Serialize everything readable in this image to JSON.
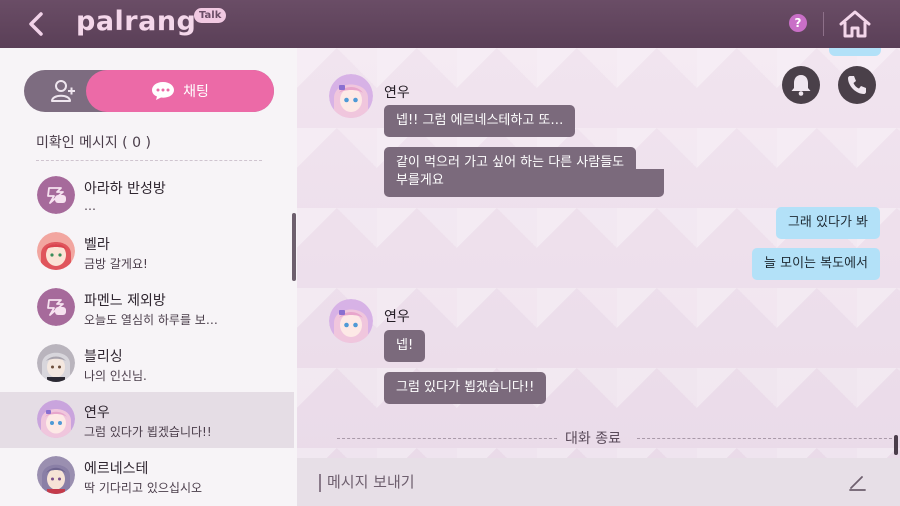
{
  "header": {
    "logo_text": "palrang",
    "logo_badge": "Talk",
    "help_label": "?"
  },
  "sidebar": {
    "tabs": {
      "chat_label": "채팅"
    },
    "unread_label": "미확인 메시지 ( 0 )",
    "chats": [
      {
        "name": "아라하 반성방",
        "preview": "…",
        "avatar": "group-icon",
        "active": false
      },
      {
        "name": "벨라",
        "preview": "금방 갈게요!",
        "avatar": "bella-avatar",
        "active": false
      },
      {
        "name": "파멘느 제외방",
        "preview": "오늘도 열심히 하루를 보…",
        "avatar": "group-icon",
        "active": false
      },
      {
        "name": "블리싱",
        "preview": "나의 인신님.",
        "avatar": "blissing-avatar",
        "active": false
      },
      {
        "name": "연우",
        "preview": "그럼 있다가 뵙겠습니다!!",
        "avatar": "yeonwoo-avatar",
        "active": true
      },
      {
        "name": "에르네스테",
        "preview": "딱 기다리고 있으십시오",
        "avatar": "erneste-avatar",
        "active": false
      }
    ]
  },
  "chat": {
    "messages": [
      {
        "sender": "연우",
        "text": "넵!! 그럼 에르네스테하고 또…"
      },
      {
        "text": "같이 먹으러 가고 싶어 하는 다른 사람들도"
      },
      {
        "text": "부를게요"
      },
      {
        "self": true,
        "text": "그래 있다가 봐"
      },
      {
        "self": true,
        "text": "늘 모이는 복도에서"
      },
      {
        "sender": "연우",
        "text": "넵!"
      },
      {
        "text": "그럼 있다가 뵙겠습니다!!"
      }
    ],
    "end_label": "대화 종료"
  },
  "input": {
    "placeholder": "메시지 보내기"
  },
  "colors": {
    "header": "#5a3f57",
    "accent": "#ec6aa7",
    "bubble_in": "#7b6a7c",
    "bubble_out": "#b3e1f8"
  }
}
